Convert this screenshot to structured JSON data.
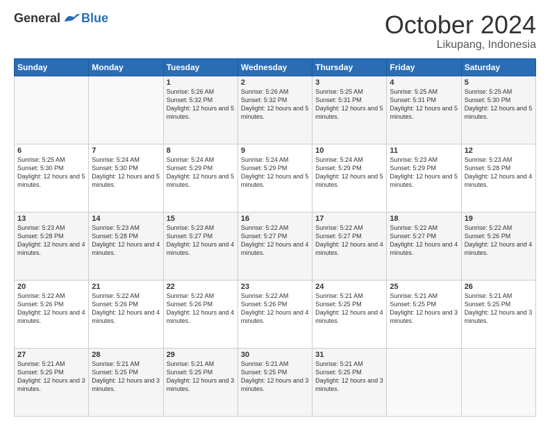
{
  "header": {
    "logo_general": "General",
    "logo_blue": "Blue",
    "month_title": "October 2024",
    "location": "Likupang, Indonesia"
  },
  "days_of_week": [
    "Sunday",
    "Monday",
    "Tuesday",
    "Wednesday",
    "Thursday",
    "Friday",
    "Saturday"
  ],
  "weeks": [
    [
      {
        "day": "",
        "info": ""
      },
      {
        "day": "",
        "info": ""
      },
      {
        "day": "1",
        "info": "Sunrise: 5:26 AM\nSunset: 5:32 PM\nDaylight: 12 hours and 5 minutes."
      },
      {
        "day": "2",
        "info": "Sunrise: 5:26 AM\nSunset: 5:32 PM\nDaylight: 12 hours and 5 minutes."
      },
      {
        "day": "3",
        "info": "Sunrise: 5:25 AM\nSunset: 5:31 PM\nDaylight: 12 hours and 5 minutes."
      },
      {
        "day": "4",
        "info": "Sunrise: 5:25 AM\nSunset: 5:31 PM\nDaylight: 12 hours and 5 minutes."
      },
      {
        "day": "5",
        "info": "Sunrise: 5:25 AM\nSunset: 5:30 PM\nDaylight: 12 hours and 5 minutes."
      }
    ],
    [
      {
        "day": "6",
        "info": "Sunrise: 5:25 AM\nSunset: 5:30 PM\nDaylight: 12 hours and 5 minutes."
      },
      {
        "day": "7",
        "info": "Sunrise: 5:24 AM\nSunset: 5:30 PM\nDaylight: 12 hours and 5 minutes."
      },
      {
        "day": "8",
        "info": "Sunrise: 5:24 AM\nSunset: 5:29 PM\nDaylight: 12 hours and 5 minutes."
      },
      {
        "day": "9",
        "info": "Sunrise: 5:24 AM\nSunset: 5:29 PM\nDaylight: 12 hours and 5 minutes."
      },
      {
        "day": "10",
        "info": "Sunrise: 5:24 AM\nSunset: 5:29 PM\nDaylight: 12 hours and 5 minutes."
      },
      {
        "day": "11",
        "info": "Sunrise: 5:23 AM\nSunset: 5:29 PM\nDaylight: 12 hours and 5 minutes."
      },
      {
        "day": "12",
        "info": "Sunrise: 5:23 AM\nSunset: 5:28 PM\nDaylight: 12 hours and 4 minutes."
      }
    ],
    [
      {
        "day": "13",
        "info": "Sunrise: 5:23 AM\nSunset: 5:28 PM\nDaylight: 12 hours and 4 minutes."
      },
      {
        "day": "14",
        "info": "Sunrise: 5:23 AM\nSunset: 5:28 PM\nDaylight: 12 hours and 4 minutes."
      },
      {
        "day": "15",
        "info": "Sunrise: 5:23 AM\nSunset: 5:27 PM\nDaylight: 12 hours and 4 minutes."
      },
      {
        "day": "16",
        "info": "Sunrise: 5:22 AM\nSunset: 5:27 PM\nDaylight: 12 hours and 4 minutes."
      },
      {
        "day": "17",
        "info": "Sunrise: 5:22 AM\nSunset: 5:27 PM\nDaylight: 12 hours and 4 minutes."
      },
      {
        "day": "18",
        "info": "Sunrise: 5:22 AM\nSunset: 5:27 PM\nDaylight: 12 hours and 4 minutes."
      },
      {
        "day": "19",
        "info": "Sunrise: 5:22 AM\nSunset: 5:26 PM\nDaylight: 12 hours and 4 minutes."
      }
    ],
    [
      {
        "day": "20",
        "info": "Sunrise: 5:22 AM\nSunset: 5:26 PM\nDaylight: 12 hours and 4 minutes."
      },
      {
        "day": "21",
        "info": "Sunrise: 5:22 AM\nSunset: 5:26 PM\nDaylight: 12 hours and 4 minutes."
      },
      {
        "day": "22",
        "info": "Sunrise: 5:22 AM\nSunset: 5:26 PM\nDaylight: 12 hours and 4 minutes."
      },
      {
        "day": "23",
        "info": "Sunrise: 5:22 AM\nSunset: 5:26 PM\nDaylight: 12 hours and 4 minutes."
      },
      {
        "day": "24",
        "info": "Sunrise: 5:21 AM\nSunset: 5:25 PM\nDaylight: 12 hours and 4 minutes."
      },
      {
        "day": "25",
        "info": "Sunrise: 5:21 AM\nSunset: 5:25 PM\nDaylight: 12 hours and 3 minutes."
      },
      {
        "day": "26",
        "info": "Sunrise: 5:21 AM\nSunset: 5:25 PM\nDaylight: 12 hours and 3 minutes."
      }
    ],
    [
      {
        "day": "27",
        "info": "Sunrise: 5:21 AM\nSunset: 5:25 PM\nDaylight: 12 hours and 3 minutes."
      },
      {
        "day": "28",
        "info": "Sunrise: 5:21 AM\nSunset: 5:25 PM\nDaylight: 12 hours and 3 minutes."
      },
      {
        "day": "29",
        "info": "Sunrise: 5:21 AM\nSunset: 5:25 PM\nDaylight: 12 hours and 3 minutes."
      },
      {
        "day": "30",
        "info": "Sunrise: 5:21 AM\nSunset: 5:25 PM\nDaylight: 12 hours and 3 minutes."
      },
      {
        "day": "31",
        "info": "Sunrise: 5:21 AM\nSunset: 5:25 PM\nDaylight: 12 hours and 3 minutes."
      },
      {
        "day": "",
        "info": ""
      },
      {
        "day": "",
        "info": ""
      }
    ]
  ]
}
